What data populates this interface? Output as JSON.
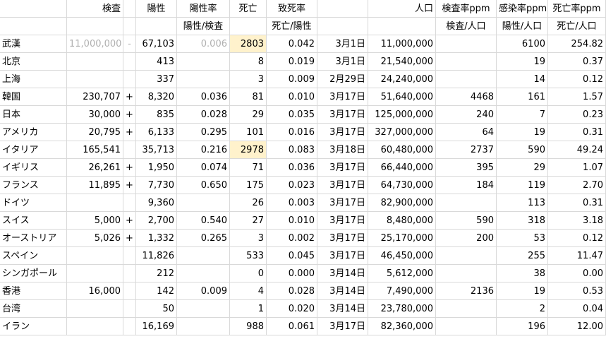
{
  "header1": [
    "",
    "検査",
    "",
    "陽性",
    "陽性率",
    "死亡",
    "致死率",
    "",
    "人口",
    "検査率ppm",
    "感染率ppm",
    "死亡率ppm"
  ],
  "header2": [
    "",
    "",
    "",
    "",
    "陽性/検査",
    "",
    "死亡/陽性",
    "",
    "",
    "検査/人口",
    "陽性/人口",
    "死亡/人口"
  ],
  "rows": [
    [
      "武漢",
      "11,000,000",
      "-",
      "67,103",
      "0.006",
      "2803",
      "0.042",
      "3月1日",
      "11,000,000",
      "",
      "6100",
      "254.82"
    ],
    [
      "北京",
      "",
      "",
      "413",
      "",
      "8",
      "0.019",
      "3月1日",
      "21,540,000",
      "",
      "19",
      "0.37"
    ],
    [
      "上海",
      "",
      "",
      "337",
      "",
      "3",
      "0.009",
      "2月29日",
      "24,240,000",
      "",
      "14",
      "0.12"
    ],
    [
      "韓国",
      "230,707",
      "+",
      "8,320",
      "0.036",
      "81",
      "0.010",
      "3月17日",
      "51,640,000",
      "4468",
      "161",
      "1.57"
    ],
    [
      "日本",
      "30,000",
      "+",
      "835",
      "0.028",
      "29",
      "0.035",
      "3月17日",
      "125,000,000",
      "240",
      "7",
      "0.23"
    ],
    [
      "アメリカ",
      "20,795",
      "+",
      "6,133",
      "0.295",
      "101",
      "0.016",
      "3月17日",
      "327,000,000",
      "64",
      "19",
      "0.31"
    ],
    [
      "イタリア",
      "165,541",
      "",
      "35,713",
      "0.216",
      "2978",
      "0.083",
      "3月18日",
      "60,480,000",
      "2737",
      "590",
      "49.24"
    ],
    [
      "イギリス",
      "26,261",
      "+",
      "1,950",
      "0.074",
      "71",
      "0.036",
      "3月17日",
      "66,440,000",
      "395",
      "29",
      "1.07"
    ],
    [
      "フランス",
      "11,895",
      "+",
      "7,730",
      "0.650",
      "175",
      "0.023",
      "3月17日",
      "64,730,000",
      "184",
      "119",
      "2.70"
    ],
    [
      "ドイツ",
      "",
      "",
      "9,360",
      "",
      "26",
      "0.003",
      "3月17日",
      "82,900,000",
      "",
      "113",
      "0.31"
    ],
    [
      "スイス",
      "5,000",
      "+",
      "2,700",
      "0.540",
      "27",
      "0.010",
      "3月17日",
      "8,480,000",
      "590",
      "318",
      "3.18"
    ],
    [
      "オーストリア",
      "5,026",
      "+",
      "1,332",
      "0.265",
      "3",
      "0.002",
      "3月17日",
      "25,170,000",
      "200",
      "53",
      "0.12"
    ],
    [
      "スペイン",
      "",
      "",
      "11,826",
      "",
      "533",
      "0.045",
      "3月17日",
      "46,450,000",
      "",
      "255",
      "11.47"
    ],
    [
      "シンガポール",
      "",
      "",
      "212",
      "",
      "0",
      "0.000",
      "3月14日",
      "5,612,000",
      "",
      "38",
      "0.00"
    ],
    [
      "香港",
      "16,000",
      "",
      "142",
      "0.009",
      "4",
      "0.028",
      "3月14日",
      "7,490,000",
      "2136",
      "19",
      "0.53"
    ],
    [
      "台湾",
      "",
      "",
      "50",
      "",
      "1",
      "0.020",
      "3月14日",
      "23,780,000",
      "",
      "2",
      "0.04"
    ],
    [
      "イラン",
      "",
      "",
      "16,169",
      "",
      "988",
      "0.061",
      "3月17日",
      "82,360,000",
      "",
      "196",
      "12.00"
    ]
  ],
  "highlight_color": "#fff2cc"
}
